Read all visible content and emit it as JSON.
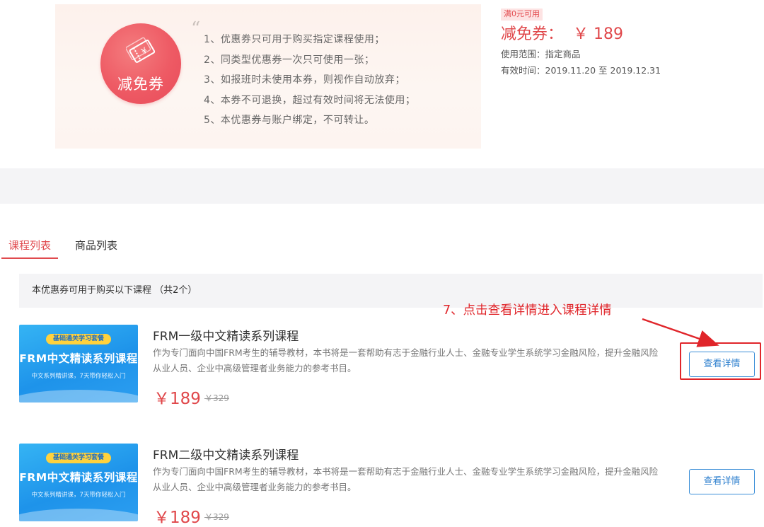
{
  "coupon": {
    "circle_label": "减免券",
    "rules": [
      "1、优惠券只可用于购买指定课程使用；",
      "2、同类型优惠券一次只可使用一张；",
      "3、如报班时未使用本券，则视作自动放弃；",
      "4、本券不可退换，超过有效时间将无法使用；",
      "5、本优惠券与账户绑定，不可转让。"
    ],
    "min_badge": "满0元可用",
    "title": "减免券：",
    "amount": "￥ 189",
    "scope": "使用范围：指定商品",
    "validity": "有效时间：2019.11.20 至 2019.12.31"
  },
  "tabs": [
    {
      "label": "课程列表",
      "active": true
    },
    {
      "label": "商品列表",
      "active": false
    }
  ],
  "list": {
    "header": "本优惠券可用于购买以下课程 （共2个）",
    "courses": [
      {
        "thumb_badge": "基础通关学习套餐",
        "thumb_title": "FRM中文精读系列课程",
        "thumb_sub": "中文系列精讲课，7天带你轻松入门",
        "title": "FRM一级中文精读系列课程",
        "desc": "作为专门面向中国FRM考生的辅导教材，本书将是一套帮助有志于金融行业人士、金融专业学生系统学习金融风险，提升金融风险从业人员、企业中高级管理者业务能力的参考书目。",
        "price": "￥189",
        "original_price": "￥329",
        "button": "查看详情"
      },
      {
        "thumb_badge": "基础通关学习套餐",
        "thumb_title": "FRM中文精读系列课程",
        "thumb_sub": "中文系列精讲课，7天带你轻松入门",
        "title": "FRM二级中文精读系列课程",
        "desc": "作为专门面向中国FRM考生的辅导教材，本书将是一套帮助有志于金融行业人士、金融专业学生系统学习金融风险，提升金融风险从业人员、企业中高级管理者业务能力的参考书目。",
        "price": "￥189",
        "original_price": "￥329",
        "button": "查看详情"
      }
    ]
  },
  "annotation": {
    "text": "7、点击查看详情进入课程详情",
    "color": "#e0252a"
  },
  "colors": {
    "accent_red": "#e0484b",
    "button_blue": "#2d7fce"
  }
}
